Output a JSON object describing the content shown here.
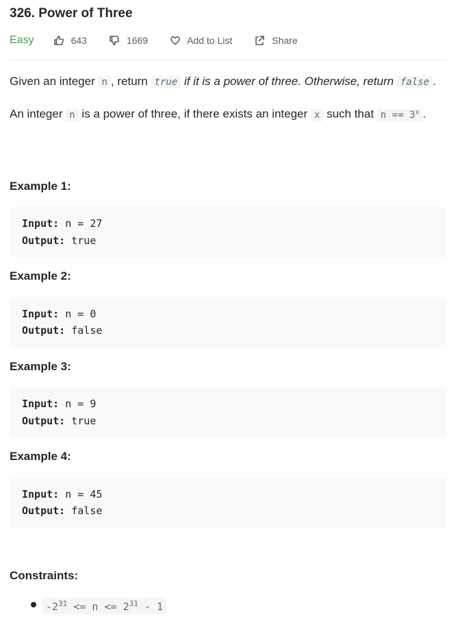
{
  "problem": {
    "title": "326. Power of Three",
    "difficulty": "Easy",
    "likes": "643",
    "dislikes": "1669",
    "add_to_list": "Add to List",
    "share": "Share"
  },
  "description": {
    "p1_text1": "Given an integer ",
    "p1_code_n": "n",
    "p1_text2": ", return ",
    "p1_code_true": "true",
    "p1_text3": " if it is a power of three. Otherwise, return ",
    "p1_code_false": "false",
    "p1_text4": ".",
    "p2_text1": "An integer ",
    "p2_code_n": "n",
    "p2_text2": " is a power of three, if there exists an integer ",
    "p2_code_x": "x",
    "p2_text3": " such that ",
    "p2_code_expr": "n == 3",
    "p2_code_sup": "x",
    "p2_text4": "."
  },
  "examples": [
    {
      "heading": "Example 1:",
      "input_label": "Input:",
      "input_value": " n = 27",
      "output_label": "Output:",
      "output_value": " true"
    },
    {
      "heading": "Example 2:",
      "input_label": "Input:",
      "input_value": " n = 0",
      "output_label": "Output:",
      "output_value": " false"
    },
    {
      "heading": "Example 3:",
      "input_label": "Input:",
      "input_value": " n = 9",
      "output_label": "Output:",
      "output_value": " true"
    },
    {
      "heading": "Example 4:",
      "input_label": "Input:",
      "input_value": " n = 45",
      "output_label": "Output:",
      "output_value": " false"
    }
  ],
  "constraints": {
    "heading": "Constraints:",
    "c1_part1": "-2",
    "c1_sup1": "31",
    "c1_part2": " <= n <= 2",
    "c1_sup2": "31",
    "c1_part3": " - 1"
  },
  "icons": {
    "like": "thumbs-up-icon",
    "dislike": "thumbs-down-icon",
    "add": "heart-icon",
    "share": "share-icon"
  },
  "colors": {
    "easy": "#43a047",
    "text": "#262626",
    "code_bg": "#f7f9fa",
    "inline_code": "#546e7a"
  }
}
